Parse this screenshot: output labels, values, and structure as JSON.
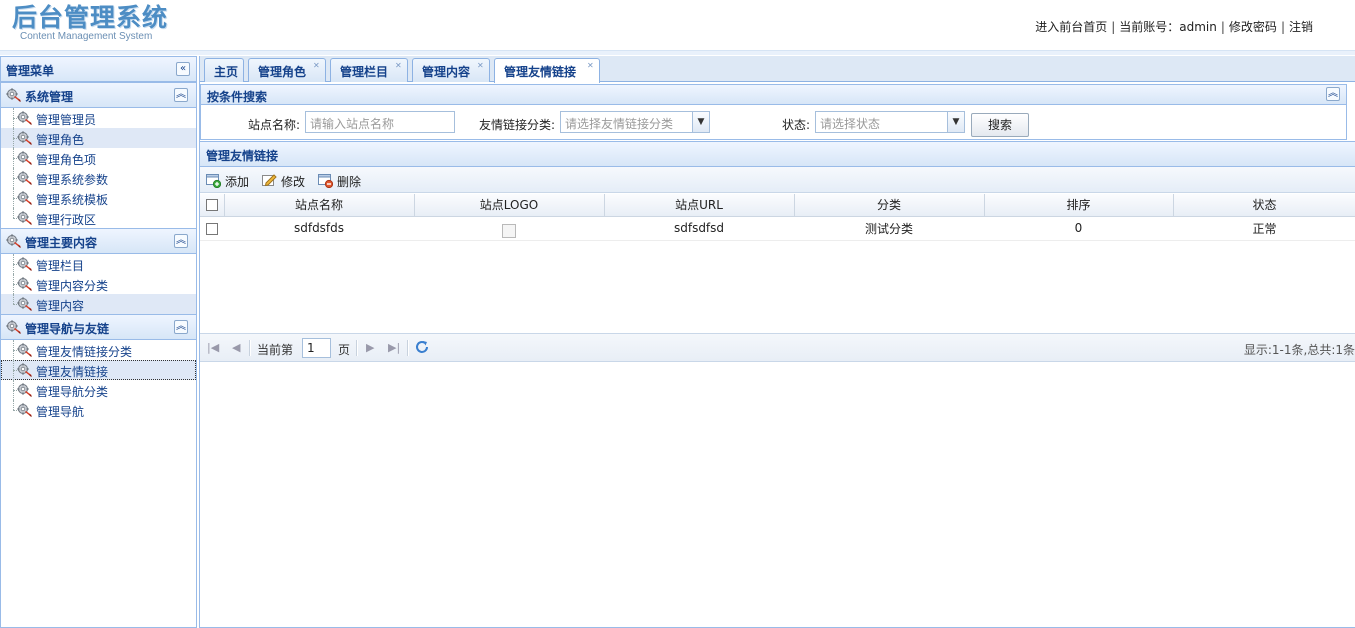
{
  "header": {
    "logo_title": "后台管理系统",
    "logo_subtitle": "Content Management System",
    "links": {
      "frontend": "进入前台首页",
      "account_prefix": "当前账号：",
      "account": "admin",
      "change_password": "修改密码",
      "logout": "注销",
      "separator": "|"
    }
  },
  "west": {
    "title": "管理菜单",
    "collapse_glyph": "«",
    "sections": [
      {
        "title": "系统管理",
        "items": [
          "管理管理员",
          "管理角色",
          "管理角色项",
          "管理系统参数",
          "管理系统模板",
          "管理行政区"
        ]
      },
      {
        "title": "管理主要内容",
        "items": [
          "管理栏目",
          "管理内容分类",
          "管理内容"
        ]
      },
      {
        "title": "管理导航与友链",
        "items": [
          "管理友情链接分类",
          "管理友情链接",
          "管理导航分类",
          "管理导航"
        ]
      }
    ],
    "section_collapse_glyph": "︽",
    "highlighted_item": "管理角色",
    "hover_item": "管理内容",
    "selected_item": "管理友情链接"
  },
  "tabs": [
    {
      "label": "主页",
      "closable": false
    },
    {
      "label": "管理角色",
      "closable": true
    },
    {
      "label": "管理栏目",
      "closable": true
    },
    {
      "label": "管理内容",
      "closable": true
    },
    {
      "label": "管理友情链接",
      "closable": true,
      "active": true
    }
  ],
  "tab_close_glyph": "✕",
  "search": {
    "title": "按条件搜索",
    "site_name_label": "站点名称:",
    "site_name_placeholder": "请输入站点名称",
    "category_label": "友情链接分类:",
    "category_placeholder": "请选择友情链接分类",
    "status_label": "状态:",
    "status_placeholder": "请选择状态",
    "search_button": "搜索",
    "dropdown_glyph": "▼",
    "collapse_glyph": "︽"
  },
  "grid": {
    "title": "管理友情链接",
    "toolbar": {
      "add": "添加",
      "edit": "修改",
      "delete": "删除"
    },
    "columns": [
      "站点名称",
      "站点LOGO",
      "站点URL",
      "分类",
      "排序",
      "状态"
    ],
    "rows": [
      {
        "site_name": "sdfdsfds",
        "logo": "",
        "url": "sdfsdfsd",
        "category": "测试分类",
        "order": "0",
        "status": "正常"
      }
    ]
  },
  "pager": {
    "current_prefix": "当前第",
    "page": "1",
    "page_suffix": "页",
    "info": "显示:1-1条,总共:1条",
    "first_glyph": "|◀",
    "prev_glyph": "◀",
    "next_glyph": "▶",
    "last_glyph": "▶|"
  },
  "colors": {
    "panel_border": "#99bbe8",
    "header_text": "#15428b",
    "logo": "#4d8dc4"
  }
}
